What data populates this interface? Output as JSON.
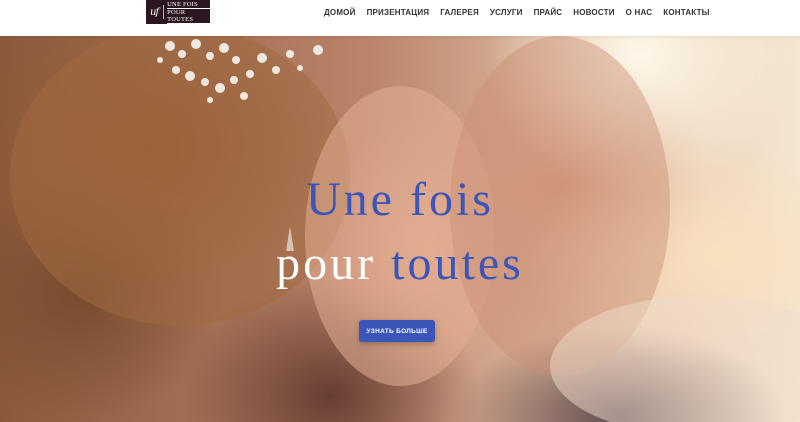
{
  "brand": {
    "logo_mark": "uf",
    "logo_line1": "Une fois",
    "logo_line2": "Pour toutes"
  },
  "nav": {
    "items": [
      {
        "label": "ДОМОЙ"
      },
      {
        "label": "ПРИЗЕНТАЦИЯ"
      },
      {
        "label": "ГАЛЕРЕЯ"
      },
      {
        "label": "УСЛУГИ"
      },
      {
        "label": "ПРАЙС"
      },
      {
        "label": "НОВОСТИ"
      },
      {
        "label": "О НАС"
      },
      {
        "label": "КОНТАКТЫ"
      }
    ]
  },
  "hero": {
    "title_line1": "Une fois",
    "title_line2_word1": "pour",
    "title_line2_word2": "toutes",
    "cta_label": "УЗНАТЬ БОЛЬШЕ"
  },
  "colors": {
    "accent": "#3b55b8",
    "logo_bg": "#2b1722",
    "nav_text": "#333333"
  }
}
